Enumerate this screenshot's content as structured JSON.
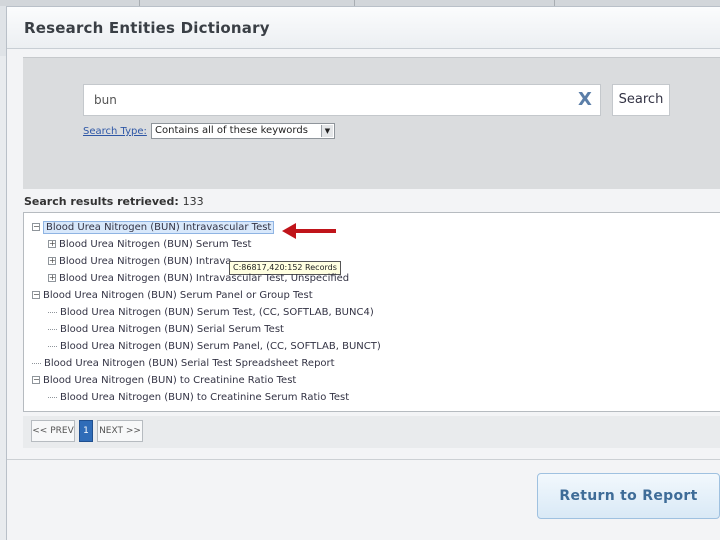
{
  "window": {
    "title": "Research Entities Dictionary"
  },
  "search": {
    "value": "bun",
    "clear_label": "X",
    "button_label": "Search",
    "type_label": "Search Type:",
    "type_selected": "Contains all of these keywords"
  },
  "results": {
    "header_label": "Search results retrieved:",
    "count": "133",
    "tree": [
      {
        "level": 0,
        "marker": "minus",
        "label": "Blood Urea Nitrogen (BUN) Intravascular Test",
        "highlighted": true
      },
      {
        "level": 1,
        "marker": "plus",
        "label": "Blood Urea Nitrogen (BUN) Serum Test"
      },
      {
        "level": 1,
        "marker": "plus",
        "label": "Blood Urea Nitrogen (BUN) Intrava"
      },
      {
        "level": 1,
        "marker": "plus",
        "label": "Blood Urea Nitrogen (BUN) Intravascular Test, Unspecified"
      },
      {
        "level": 0,
        "marker": "minus",
        "label": "Blood Urea Nitrogen (BUN) Serum Panel or Group Test"
      },
      {
        "level": 1,
        "marker": "line",
        "label": "Blood Urea Nitrogen (BUN) Serum Test, (CC, SOFTLAB, BUNC4)"
      },
      {
        "level": 1,
        "marker": "line",
        "label": "Blood Urea Nitrogen (BUN) Serial Serum Test"
      },
      {
        "level": 1,
        "marker": "line",
        "label": "Blood Urea Nitrogen (BUN) Serum Panel, (CC, SOFTLAB, BUNCT)"
      },
      {
        "level": 0,
        "marker": "line",
        "label": "Blood Urea Nitrogen (BUN) Serial Test Spreadsheet Report"
      },
      {
        "level": 0,
        "marker": "minus",
        "label": "Blood Urea Nitrogen (BUN) to Creatinine Ratio Test"
      },
      {
        "level": 1,
        "marker": "line",
        "label": "Blood Urea Nitrogen (BUN) to Creatinine Serum Ratio Test"
      }
    ],
    "tooltip": "C:86817,420:152 Records"
  },
  "pager": {
    "prev_label": "<< PREV",
    "current_page": "1",
    "next_label": "NEXT >>"
  },
  "footer": {
    "return_label": "Return to Report"
  },
  "colors": {
    "accent_blue": "#2f6cb8",
    "highlight_bg": "#d8e8fb",
    "arrow_red": "#c0141a"
  },
  "icons": {
    "clear": "close-icon",
    "expand": "plus-square-icon",
    "collapse": "minus-square-icon",
    "pointer": "red-arrow-icon"
  }
}
